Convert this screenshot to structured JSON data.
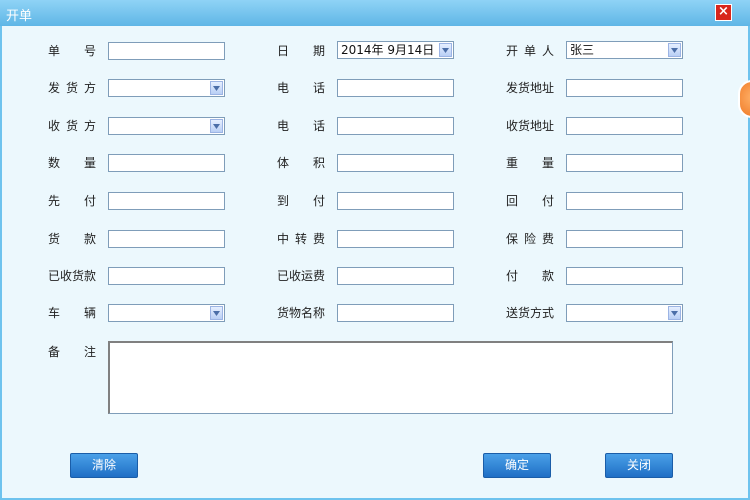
{
  "window": {
    "title": "开单"
  },
  "form": {
    "row1": {
      "order_no": "单　号",
      "date": "日　期",
      "date_value": "2014年 9月14日",
      "creator": "开单人",
      "creator_value": "张三"
    },
    "row2": {
      "shipper": "发货方",
      "phone": "电　话",
      "shipper_address": "发货地址"
    },
    "row3": {
      "receiver": "收货方",
      "phone": "电　话",
      "receiver_address": "收货地址"
    },
    "row4": {
      "quantity": "数　量",
      "volume": "体　积",
      "weight": "重　量"
    },
    "row5": {
      "prepaid": "先　付",
      "collect": "到　付",
      "return_pay": "回　付"
    },
    "row6": {
      "goods_payment": "货　款",
      "transfer_fee": "中转费",
      "insurance_fee": "保险费"
    },
    "row7": {
      "collected_payment": "已收货款",
      "collected_freight": "已收运费",
      "payment": "付　款"
    },
    "row8": {
      "vehicle": "车　辆",
      "goods_name": "货物名称",
      "delivery_method": "送货方式"
    },
    "notes": "备　注"
  },
  "buttons": {
    "clear": "清除",
    "confirm": "确定",
    "close": "关闭"
  },
  "icons": {
    "close": "close-icon",
    "dropdown": "chevron-down-icon",
    "side_tab": "side-tab-icon"
  },
  "colors": {
    "title_bar": "#6ec3ee",
    "background": "#ecf8fd",
    "button": "#2f86d8",
    "close": "#d8261c"
  }
}
